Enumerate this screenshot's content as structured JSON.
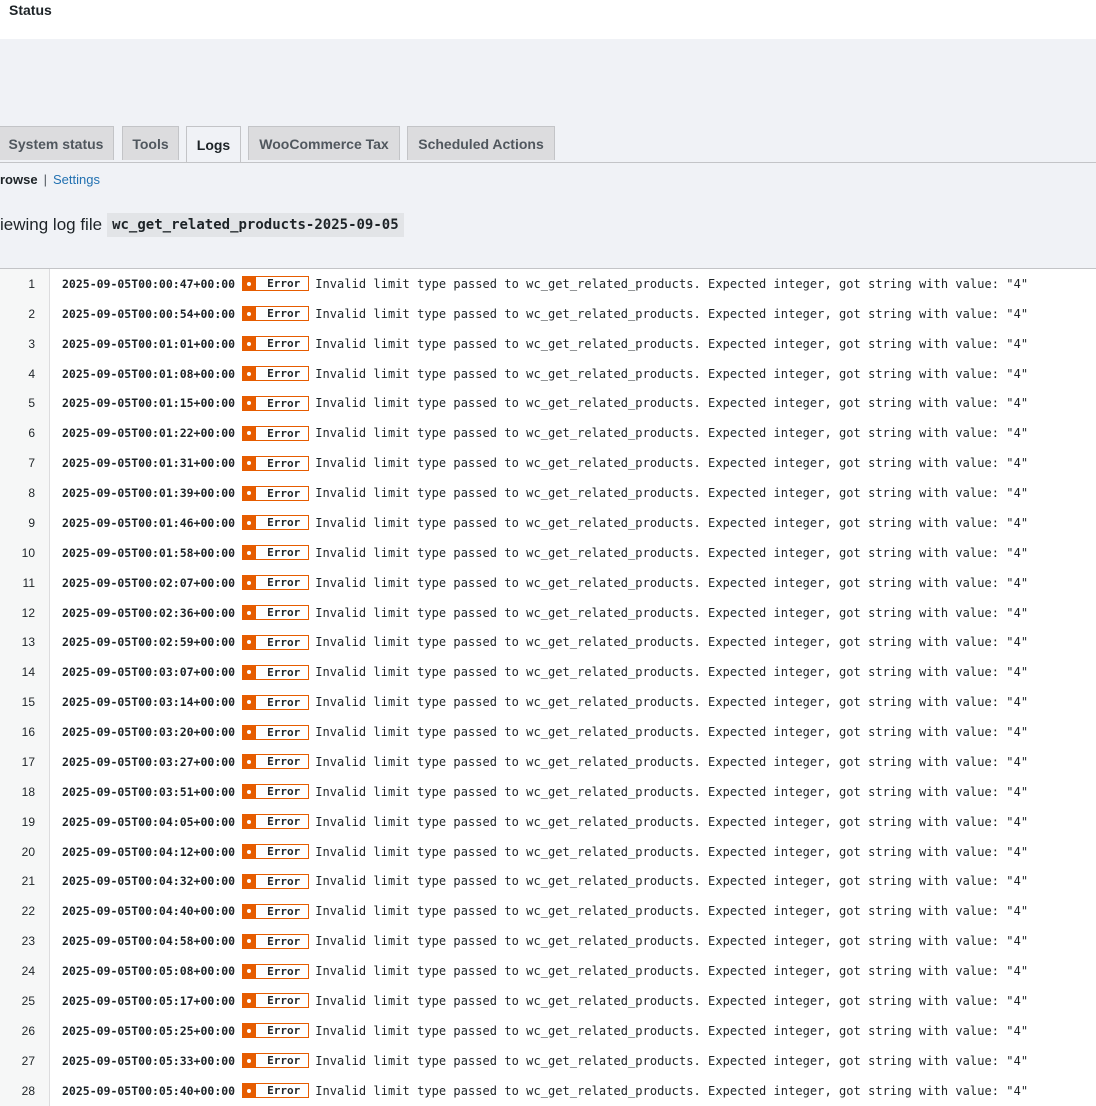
{
  "header": {
    "title": "Status"
  },
  "tabs": [
    {
      "label": "System status",
      "active": false
    },
    {
      "label": "Tools",
      "active": false
    },
    {
      "label": "Logs",
      "active": true
    },
    {
      "label": "WooCommerce Tax",
      "active": false
    },
    {
      "label": "Scheduled Actions",
      "active": false
    }
  ],
  "subnav": {
    "current": "rowse",
    "separator": "|",
    "settings": "Settings"
  },
  "viewing": {
    "prefix": "iewing log file",
    "filename": "wc_get_related_products-2025-09-05"
  },
  "colors": {
    "error_accent": "#e65c00",
    "link": "#2271b1"
  },
  "log": {
    "level": "Error",
    "level_icon": "error-dot-icon",
    "message": "Invalid limit type passed to wc_get_related_products. Expected integer, got string with value: \"4\"",
    "lines": [
      {
        "n": "1",
        "ts": "2025-09-05T00:00:47+00:00"
      },
      {
        "n": "2",
        "ts": "2025-09-05T00:00:54+00:00"
      },
      {
        "n": "3",
        "ts": "2025-09-05T00:01:01+00:00"
      },
      {
        "n": "4",
        "ts": "2025-09-05T00:01:08+00:00"
      },
      {
        "n": "5",
        "ts": "2025-09-05T00:01:15+00:00"
      },
      {
        "n": "6",
        "ts": "2025-09-05T00:01:22+00:00"
      },
      {
        "n": "7",
        "ts": "2025-09-05T00:01:31+00:00"
      },
      {
        "n": "8",
        "ts": "2025-09-05T00:01:39+00:00"
      },
      {
        "n": "9",
        "ts": "2025-09-05T00:01:46+00:00"
      },
      {
        "n": "10",
        "ts": "2025-09-05T00:01:58+00:00"
      },
      {
        "n": "11",
        "ts": "2025-09-05T00:02:07+00:00"
      },
      {
        "n": "12",
        "ts": "2025-09-05T00:02:36+00:00"
      },
      {
        "n": "13",
        "ts": "2025-09-05T00:02:59+00:00"
      },
      {
        "n": "14",
        "ts": "2025-09-05T00:03:07+00:00"
      },
      {
        "n": "15",
        "ts": "2025-09-05T00:03:14+00:00"
      },
      {
        "n": "16",
        "ts": "2025-09-05T00:03:20+00:00"
      },
      {
        "n": "17",
        "ts": "2025-09-05T00:03:27+00:00"
      },
      {
        "n": "18",
        "ts": "2025-09-05T00:03:51+00:00"
      },
      {
        "n": "19",
        "ts": "2025-09-05T00:04:05+00:00"
      },
      {
        "n": "20",
        "ts": "2025-09-05T00:04:12+00:00"
      },
      {
        "n": "21",
        "ts": "2025-09-05T00:04:32+00:00"
      },
      {
        "n": "22",
        "ts": "2025-09-05T00:04:40+00:00"
      },
      {
        "n": "23",
        "ts": "2025-09-05T00:04:58+00:00"
      },
      {
        "n": "24",
        "ts": "2025-09-05T00:05:08+00:00"
      },
      {
        "n": "25",
        "ts": "2025-09-05T00:05:17+00:00"
      },
      {
        "n": "26",
        "ts": "2025-09-05T00:05:25+00:00"
      },
      {
        "n": "27",
        "ts": "2025-09-05T00:05:33+00:00"
      },
      {
        "n": "28",
        "ts": "2025-09-05T00:05:40+00:00"
      }
    ]
  }
}
